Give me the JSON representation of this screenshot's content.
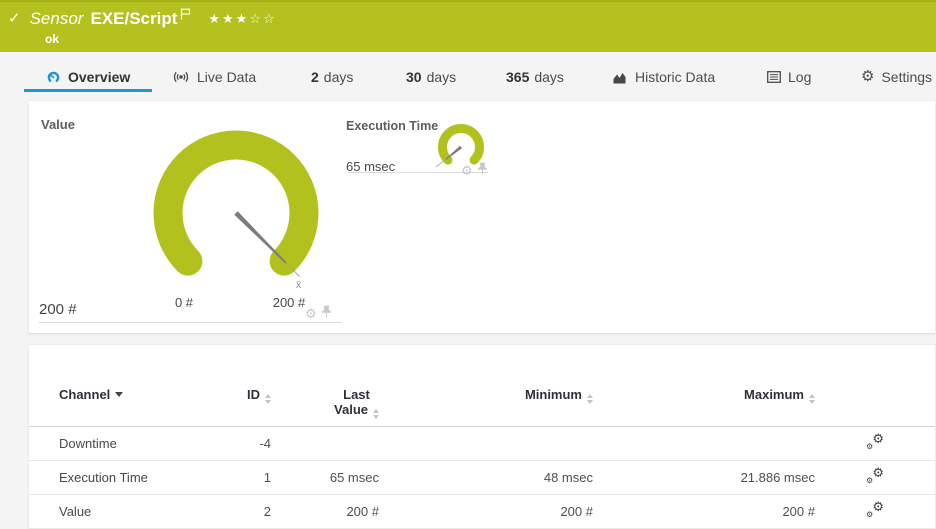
{
  "header": {
    "check": "✓",
    "kind": "Sensor",
    "name": "EXE/Script",
    "status": "ok",
    "stars_filled": "★★★",
    "stars_empty": "☆☆"
  },
  "tabs": {
    "overview": "Overview",
    "live_data": "Live Data",
    "d2_num": "2",
    "d2_label": "days",
    "d30_num": "30",
    "d30_label": "days",
    "d365_num": "365",
    "d365_label": "days",
    "historic": "Historic Data",
    "log": "Log",
    "settings": "Settings"
  },
  "icons": {
    "gear": "⚙"
  },
  "gauge_value": {
    "title": "Value",
    "current": "200 #",
    "min": "0 #",
    "max": "200 #",
    "avg_marker": "x̄"
  },
  "gauge_exec": {
    "title": "Execution Time",
    "current": "65 msec"
  },
  "table": {
    "header": {
      "channel": "Channel",
      "id": "ID",
      "last1": "Last",
      "last2": "Value",
      "minimum": "Minimum",
      "maximum": "Maximum"
    },
    "rows": [
      {
        "channel": "Downtime",
        "id": "-4",
        "last": "",
        "min": "",
        "max": ""
      },
      {
        "channel": "Execution Time",
        "id": "1",
        "last": "65 msec",
        "min": "48 msec",
        "max": "21.886 msec"
      },
      {
        "channel": "Value",
        "id": "2",
        "last": "200 #",
        "min": "200 #",
        "max": "200 #"
      }
    ]
  },
  "colors": {
    "status_green": "#b4c11e",
    "gauge_green": "#b2c11d",
    "accent_blue": "#1b97d5",
    "needle_gray": "#7d7d7d"
  }
}
